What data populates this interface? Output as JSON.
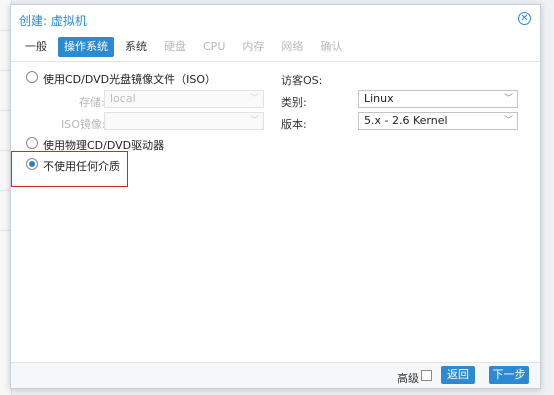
{
  "dialog": {
    "title": "创建: 虚拟机",
    "close_icon": "close-icon"
  },
  "tabs": [
    {
      "label": "一般",
      "state": "normal"
    },
    {
      "label": "操作系统",
      "state": "active"
    },
    {
      "label": "系统",
      "state": "normal"
    },
    {
      "label": "硬盘",
      "state": "disabled"
    },
    {
      "label": "CPU",
      "state": "disabled"
    },
    {
      "label": "内存",
      "state": "disabled"
    },
    {
      "label": "网络",
      "state": "disabled"
    },
    {
      "label": "确认",
      "state": "disabled"
    }
  ],
  "media": {
    "iso_option": {
      "label": "使用CD/DVD光盘镜像文件（ISO）",
      "checked": false
    },
    "storage": {
      "label": "存储:",
      "value": "local",
      "disabled": true
    },
    "iso_image": {
      "label": "ISO镜像:",
      "value": "",
      "disabled": true
    },
    "physical_option": {
      "label": "使用物理CD/DVD驱动器",
      "checked": false
    },
    "none_option": {
      "label": "不使用任何介质",
      "checked": true
    }
  },
  "guest_os": {
    "heading": "访客OS:",
    "type": {
      "label": "类别:",
      "value": "Linux"
    },
    "version": {
      "label": "版本:",
      "value": "5.x - 2.6 Kernel"
    }
  },
  "footer": {
    "advanced_label": "高级",
    "advanced_checked": false,
    "back_label": "返回",
    "next_label": "下一步"
  },
  "colors": {
    "accent": "#2b8ad1",
    "highlight": "#d9232e"
  }
}
